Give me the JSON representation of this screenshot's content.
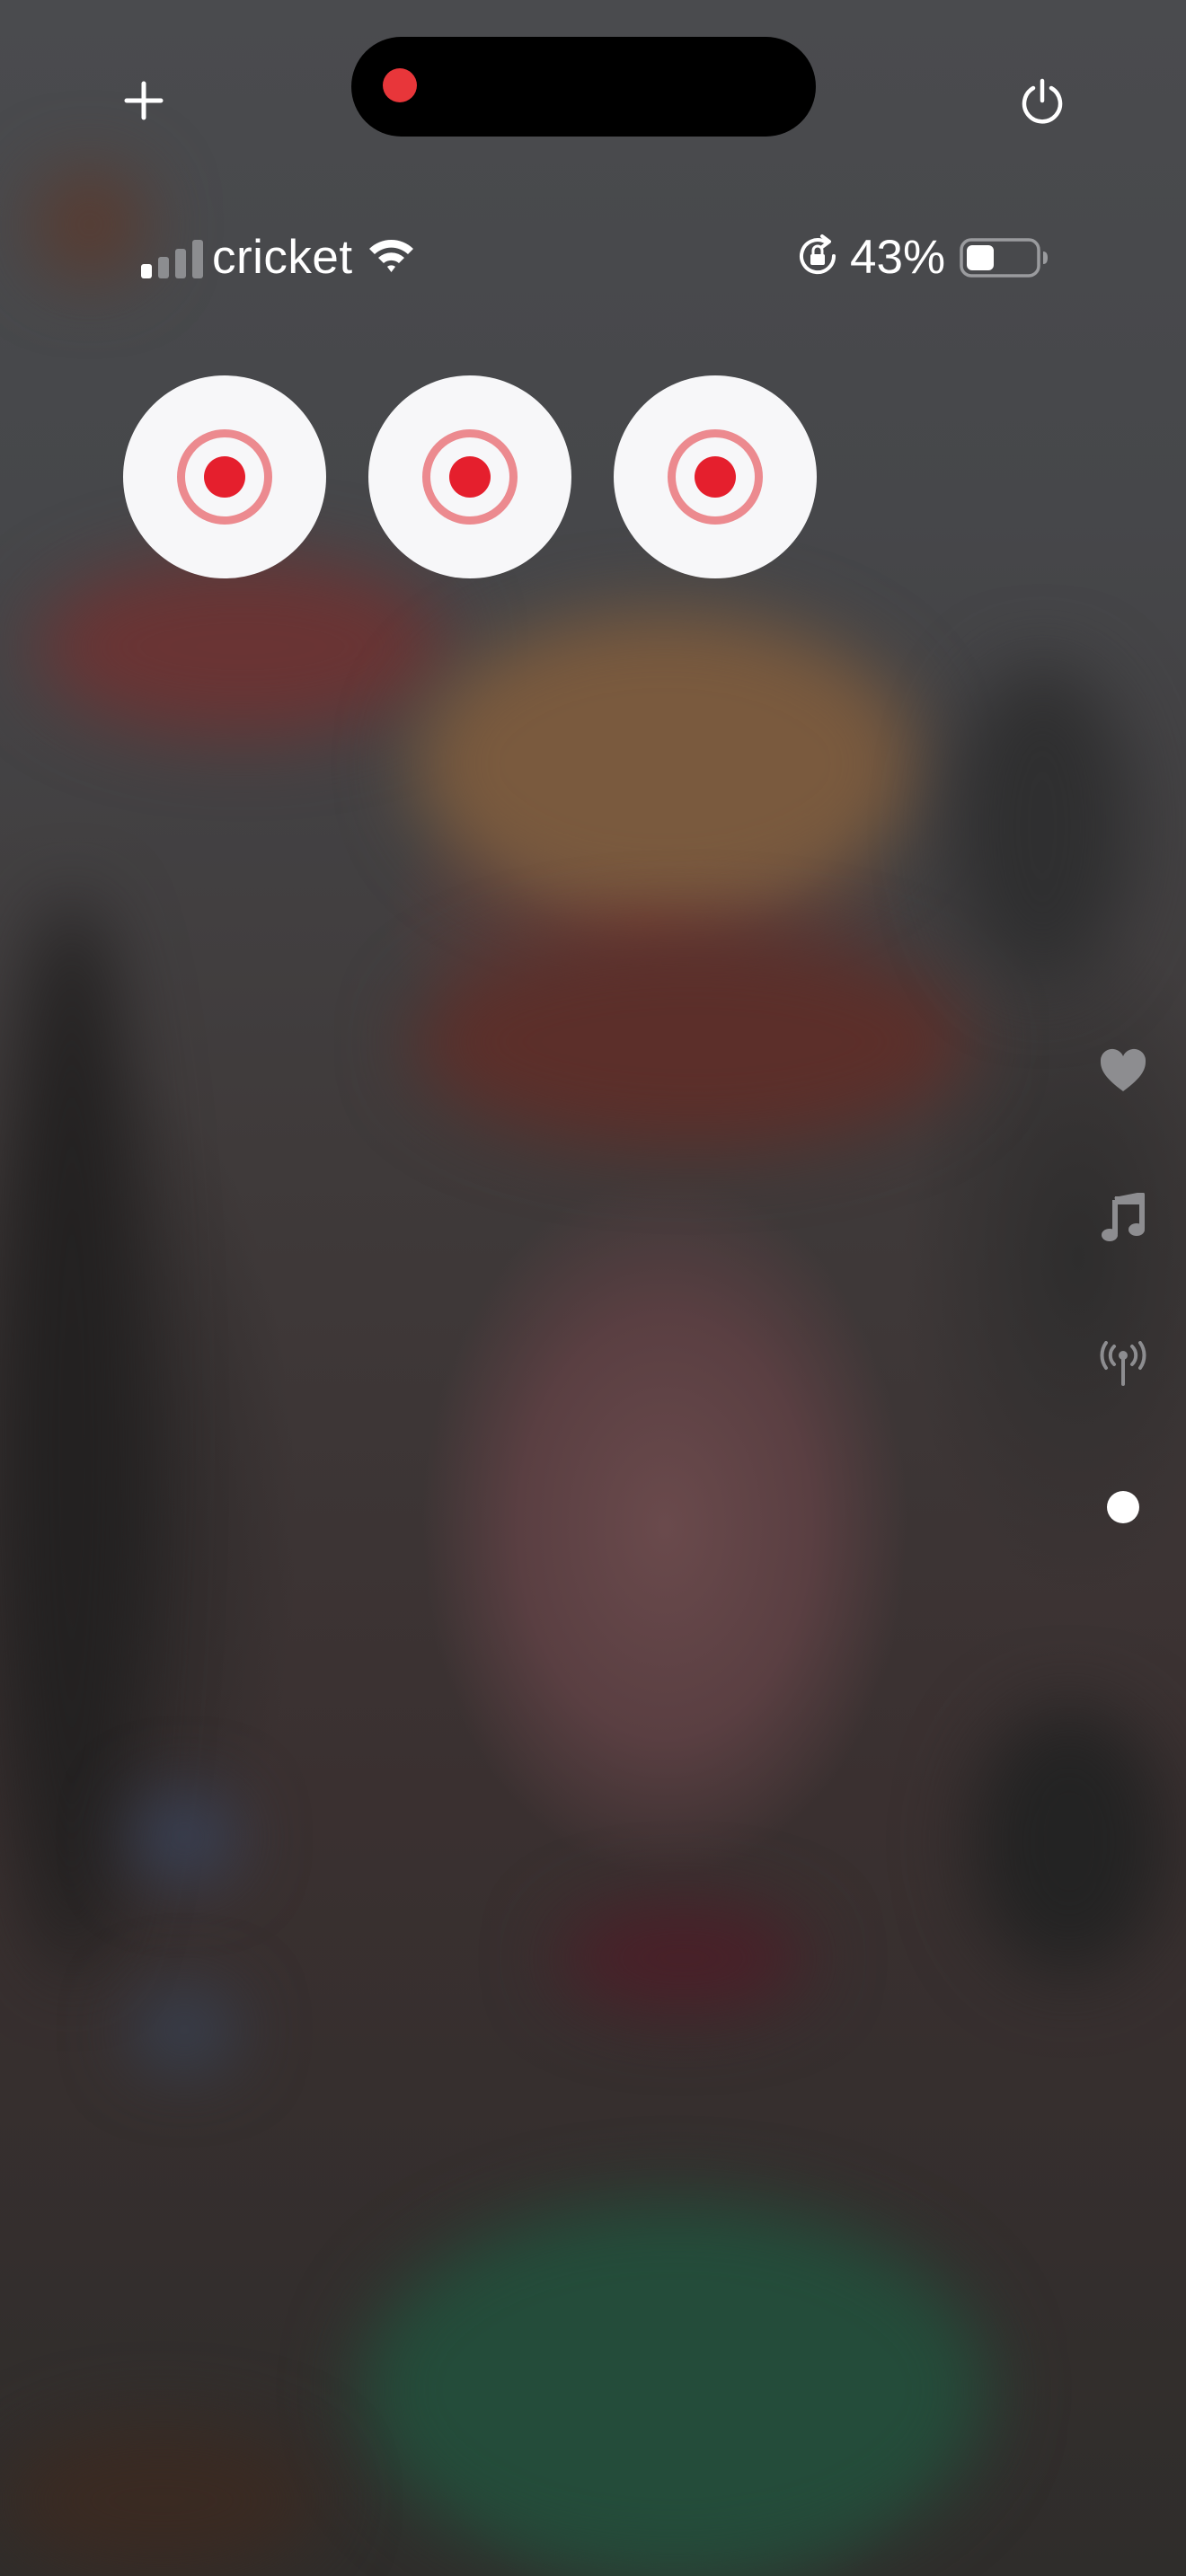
{
  "status_bar": {
    "carrier": "cricket",
    "battery_percent": "43%",
    "battery_level": 0.43,
    "signal_bars_active": 1,
    "signal_bars_total": 4
  },
  "icons": {
    "add": "plus-icon",
    "power": "power-icon",
    "record": "record-icon",
    "heart": "heart-icon",
    "music": "music-note-icon",
    "broadcast": "antenna-icon",
    "dot": "dot-icon"
  },
  "colors": {
    "record_red": "#e51f2d",
    "record_ring": "#ec8a8f",
    "island_dot": "#e8363a"
  }
}
